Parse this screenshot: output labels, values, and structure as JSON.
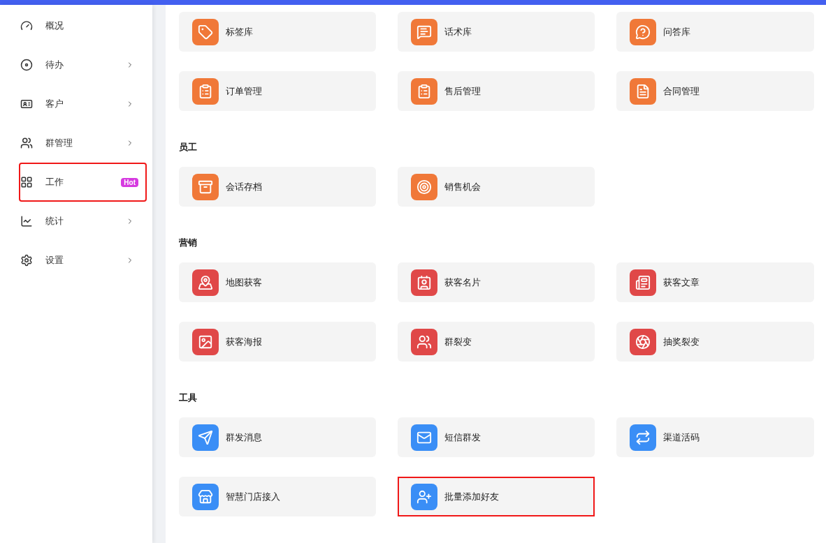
{
  "sidebar": {
    "items": [
      {
        "label": "概况",
        "has_children": false,
        "highlighted": false
      },
      {
        "label": "待办",
        "has_children": true,
        "highlighted": false
      },
      {
        "label": "客户",
        "has_children": true,
        "highlighted": false
      },
      {
        "label": "群管理",
        "has_children": true,
        "highlighted": false
      },
      {
        "label": "工作",
        "has_children": false,
        "highlighted": true,
        "badge": "Hot"
      },
      {
        "label": "统计",
        "has_children": true,
        "highlighted": false
      },
      {
        "label": "设置",
        "has_children": true,
        "highlighted": false
      }
    ]
  },
  "sections": [
    {
      "color": "#f07838",
      "items": [
        {
          "label": "标签库",
          "highlighted": false
        },
        {
          "label": "话术库",
          "highlighted": false
        },
        {
          "label": "问答库",
          "highlighted": false
        },
        {
          "label": "订单管理",
          "highlighted": false
        },
        {
          "label": "售后管理",
          "highlighted": false
        },
        {
          "label": "合同管理",
          "highlighted": false
        }
      ]
    },
    {
      "title": "员工",
      "color": "#f07838",
      "items": [
        {
          "label": "会话存档",
          "highlighted": false
        },
        {
          "label": "销售机会",
          "highlighted": false
        }
      ]
    },
    {
      "title": "营销",
      "color": "#e04848",
      "items": [
        {
          "label": "地图获客",
          "highlighted": false
        },
        {
          "label": "获客名片",
          "highlighted": false
        },
        {
          "label": "获客文章",
          "highlighted": false
        },
        {
          "label": "获客海报",
          "highlighted": false
        },
        {
          "label": "群裂变",
          "highlighted": false
        },
        {
          "label": "抽奖裂变",
          "highlighted": false
        }
      ]
    },
    {
      "title": "工具",
      "color": "#3a8ef6",
      "items": [
        {
          "label": "群发消息",
          "highlighted": false
        },
        {
          "label": "短信群发",
          "highlighted": false
        },
        {
          "label": "渠道活码",
          "highlighted": false
        },
        {
          "label": "智慧门店接入",
          "highlighted": false
        },
        {
          "label": "批量添加好友",
          "highlighted": true
        }
      ]
    }
  ]
}
